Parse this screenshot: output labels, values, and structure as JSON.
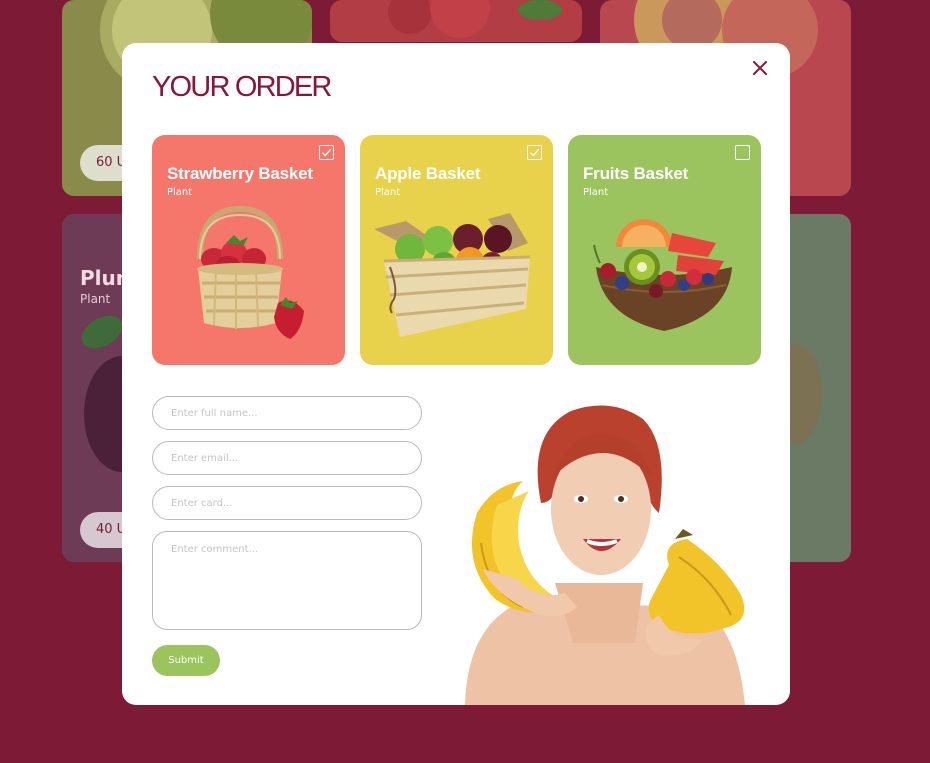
{
  "background_cards": {
    "lime_price": "60 U",
    "plum_title": "Plum",
    "plum_subtitle": "Plant",
    "plum_price": "40 U"
  },
  "modal": {
    "title": "YOUR ORDER",
    "close_icon": "close-icon"
  },
  "baskets": [
    {
      "name": "Strawberry Basket",
      "subtitle": "Plant",
      "checked": true,
      "color": "#f5766b"
    },
    {
      "name": "Apple Basket",
      "subtitle": "Plant",
      "checked": true,
      "color": "#e8d24c"
    },
    {
      "name": "Fruits Basket",
      "subtitle": "Plant",
      "checked": false,
      "color": "#9bc45f"
    }
  ],
  "form": {
    "full_name_placeholder": "Enter full name...",
    "email_placeholder": "Enter email...",
    "card_placeholder": "Enter card...",
    "comment_placeholder": "Enter comment...",
    "submit_label": "Submit"
  },
  "colors": {
    "page_background": "#7d1b36",
    "accent": "#8b1538",
    "submit": "#9bc45c"
  }
}
